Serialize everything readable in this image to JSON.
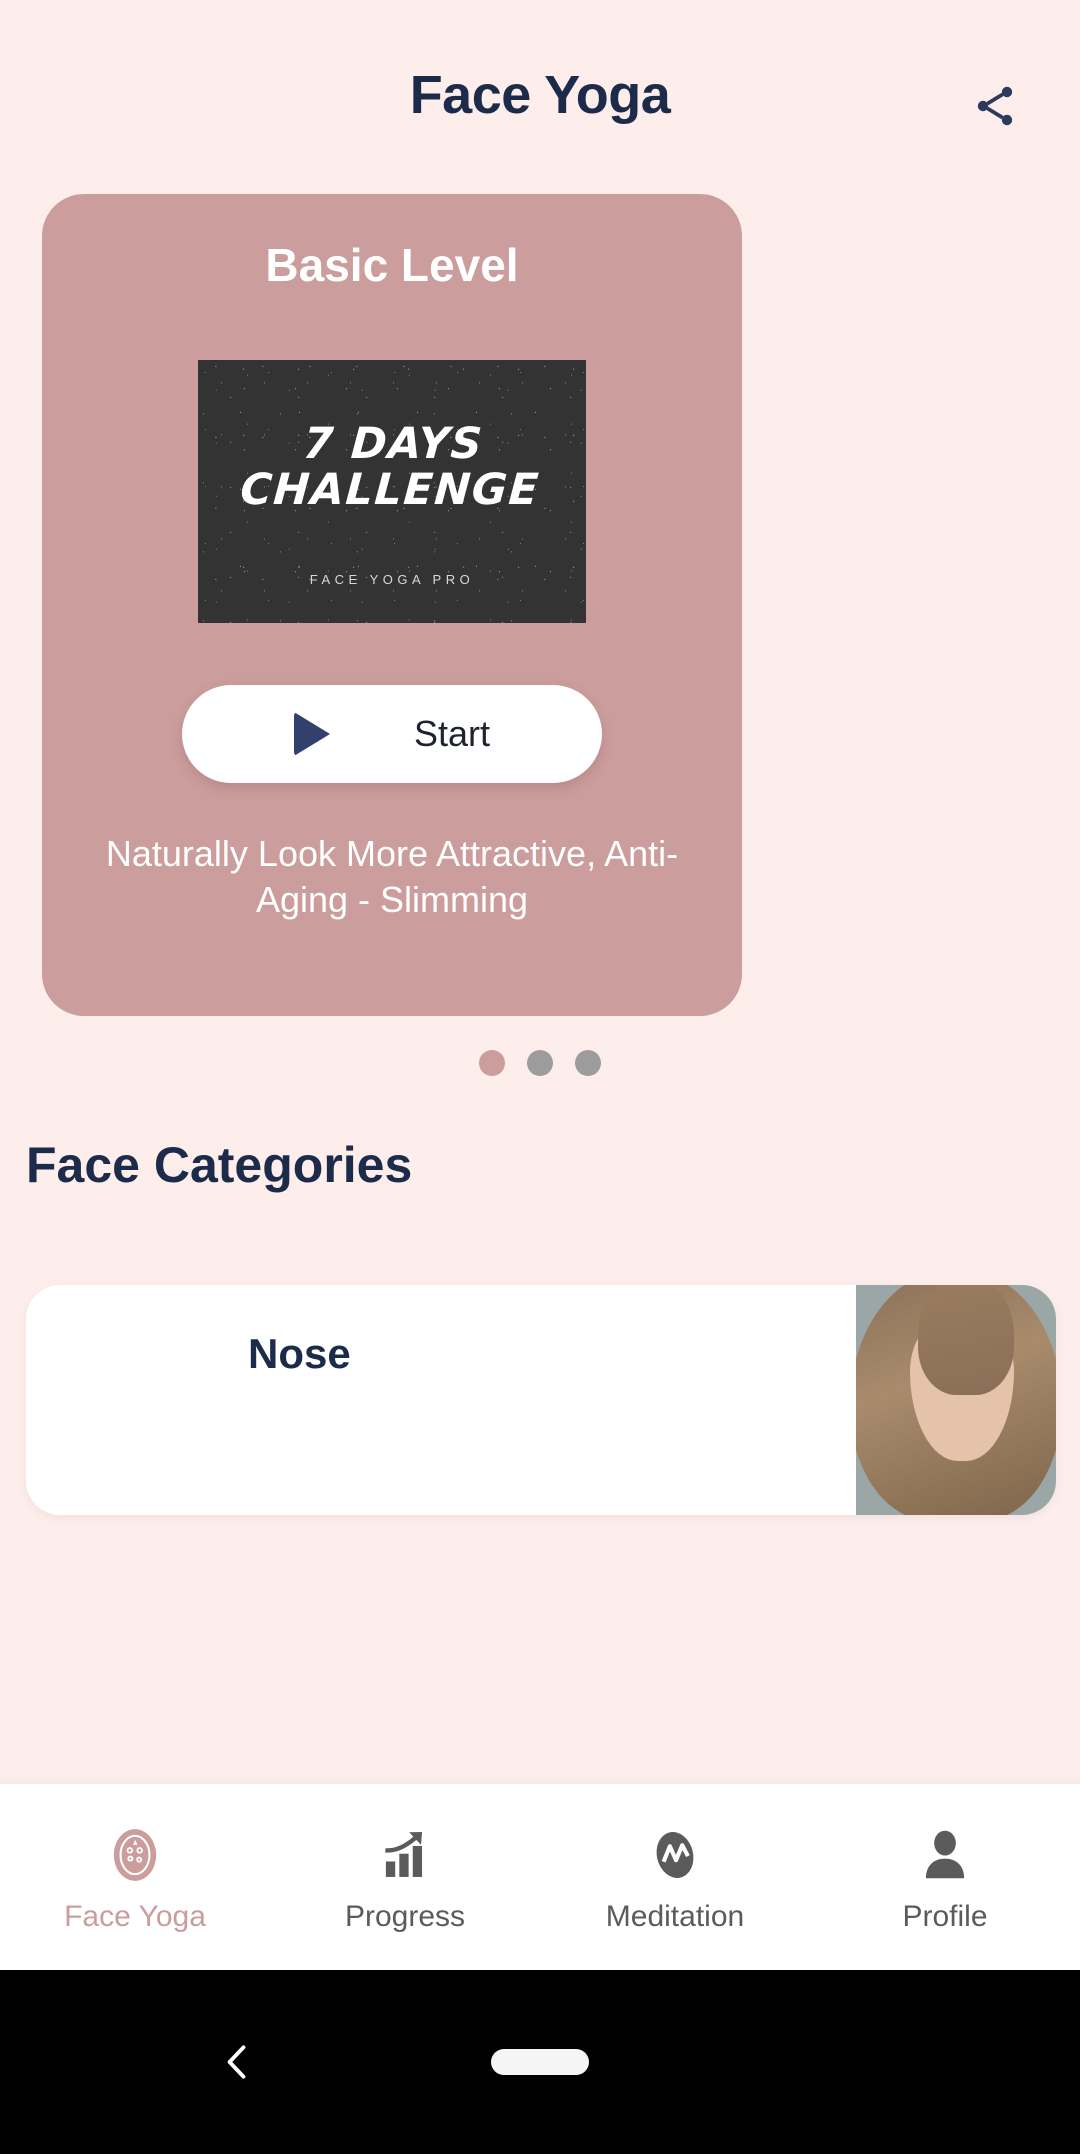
{
  "header": {
    "title": "Face Yoga",
    "share_icon": "share-icon"
  },
  "hero": {
    "level": "Basic Level",
    "thumbnail": {
      "title_line1": "7 DAYS",
      "title_line2": "CHALLENGE",
      "brand": "FACE YOGA PRO"
    },
    "start_label": "Start",
    "play_icon": "play-icon",
    "description": "Naturally Look More Attractive, Anti-Aging - Slimming"
  },
  "carousel": {
    "dots": [
      {
        "active": true
      },
      {
        "active": false
      },
      {
        "active": false
      }
    ]
  },
  "categories": {
    "section_title": "Face Categories",
    "items": [
      {
        "name": "Nose"
      }
    ]
  },
  "bottom_nav": {
    "items": [
      {
        "label": "Face Yoga",
        "icon": "face-yoga-icon",
        "active": true
      },
      {
        "label": "Progress",
        "icon": "bar-chart-icon",
        "active": false
      },
      {
        "label": "Meditation",
        "icon": "meditation-icon",
        "active": false
      },
      {
        "label": "Profile",
        "icon": "person-icon",
        "active": false
      }
    ]
  },
  "system_bar": {
    "back_icon": "back-chevron-icon",
    "home_indicator": "home-pill-icon"
  },
  "colors": {
    "background": "#fdeeec",
    "card": "#cb9d9d",
    "accent_navy": "#1d2b4a",
    "play_navy": "#31406d",
    "thumbnail": "#333333",
    "dot_inactive": "#9c9c9c"
  }
}
